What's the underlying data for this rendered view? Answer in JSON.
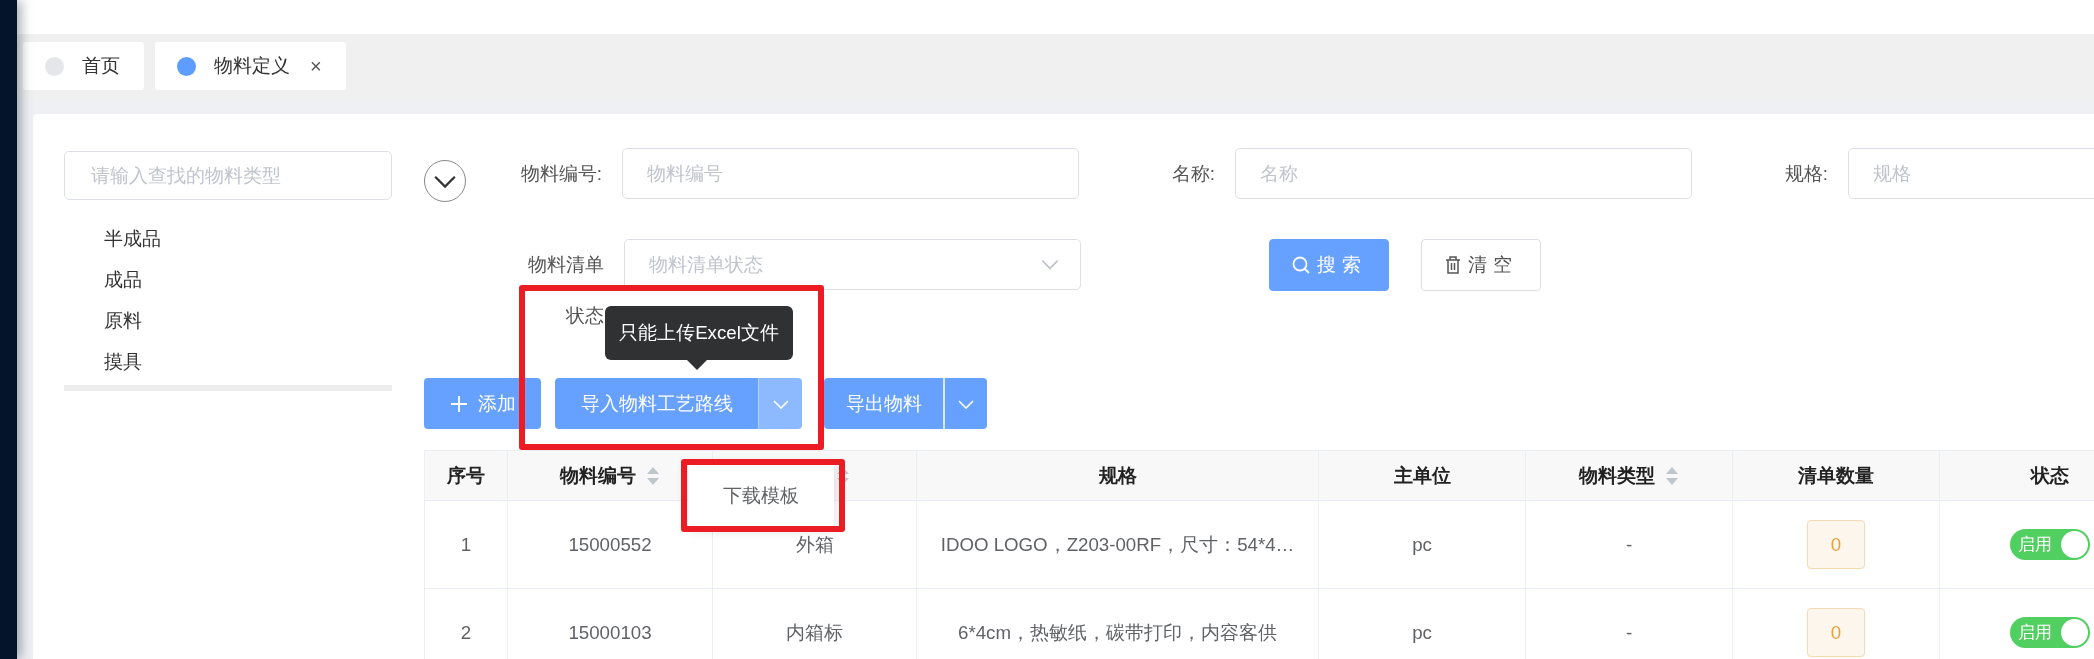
{
  "nav_tabs": [
    {
      "label": "首页",
      "selected": false
    },
    {
      "label": "物料定义",
      "selected": true,
      "close": "×"
    }
  ],
  "tree": {
    "search_placeholder": "请输入查找的物料类型",
    "items": [
      {
        "label": "半成品"
      },
      {
        "label": "成品"
      },
      {
        "label": "原料"
      },
      {
        "label": "摸具"
      }
    ]
  },
  "filters": [
    {
      "fields": [
        {
          "kind": "input",
          "label": "物料编号:",
          "placeholder": "物料编号"
        },
        {
          "kind": "input",
          "label": "名称:",
          "placeholder": "名称"
        },
        {
          "kind": "input",
          "label": "规格:",
          "placeholder": "规格"
        }
      ]
    },
    {
      "fields": [
        {
          "kind": "select",
          "label": "物料清单状态",
          "placeholder": "物料清单状态"
        }
      ]
    }
  ],
  "search_buttons": [
    {
      "kind": "search",
      "label": "搜索"
    },
    {
      "kind": "clear",
      "label": "清空"
    }
  ],
  "toolbar": [
    {
      "kind": "add",
      "label": "添加"
    },
    {
      "kind": "split",
      "label": "导入物料工艺路线",
      "expanded": true,
      "highlighted": true,
      "tooltip": "只能上传Excel文件",
      "menu": {
        "highlighted": true,
        "items": [
          {
            "label": "下载模板"
          }
        ]
      }
    },
    {
      "kind": "split",
      "label": "导出物料",
      "expanded": false
    }
  ],
  "table": {
    "columns": [
      {
        "label": "序号",
        "sortable": false
      },
      {
        "label": "物料编号",
        "sortable": true
      },
      {
        "sortable": true
      },
      {
        "label": "规格",
        "sortable": false
      },
      {
        "label": "主单位",
        "sortable": false
      },
      {
        "label": "物料类型",
        "sortable": true
      },
      {
        "label": "清单数量",
        "sortable": false
      },
      {
        "label": "状态",
        "sortable": false
      }
    ],
    "rows": [
      {
        "cells": [
          "1",
          "15000552",
          "外箱",
          "IDOO LOGO，Z203-00RF，尺寸：54*4…",
          "pc",
          "-"
        ],
        "count": "0",
        "status": {
          "label": "启用",
          "on": true
        }
      },
      {
        "cells": [
          "2",
          "15000103",
          "内箱标",
          "6*4cm，热敏纸，碳带打印，内容客供",
          "pc",
          "-"
        ],
        "count": "0",
        "status": {
          "label": "启用",
          "on": true
        }
      }
    ]
  }
}
